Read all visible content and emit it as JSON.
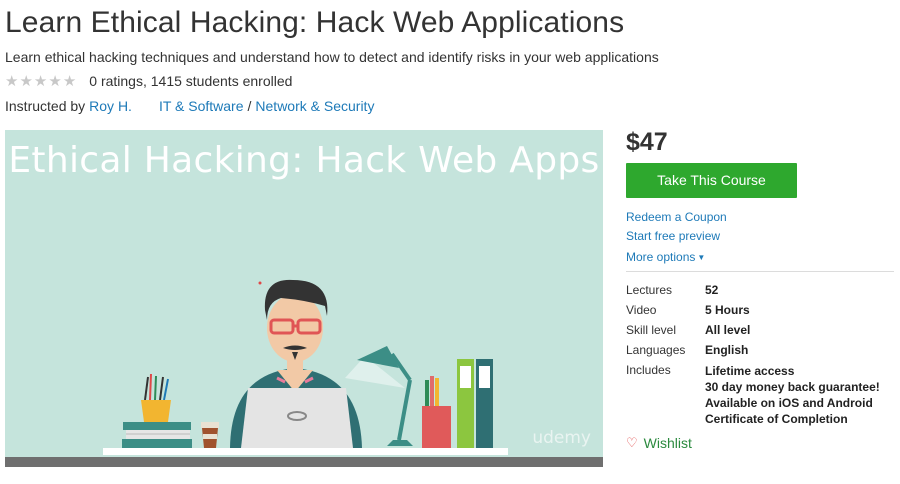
{
  "course": {
    "title": "Learn Ethical Hacking: Hack Web Applications",
    "subtitle": "Learn ethical hacking techniques and understand how to detect and identify risks in your web applications",
    "rating": 0,
    "rating_text": "0 ratings, 1415 students enrolled",
    "instructed_by": "Instructed by",
    "instructor": "Roy H.",
    "category": "IT & Software",
    "category_sep": "/",
    "subcategory": "Network & Security"
  },
  "hero": {
    "banner_text": "Ethical Hacking: Hack Web Apps",
    "brand": "udemy",
    "bg_color": "#c5e4dc"
  },
  "sidebar": {
    "price": "$47",
    "cta_label": "Take This Course",
    "cta_color": "#2ea82e",
    "redeem_coupon": "Redeem a Coupon",
    "free_preview": "Start free preview",
    "more_options": "More options",
    "details": [
      {
        "label": "Lectures",
        "value": [
          "52"
        ]
      },
      {
        "label": "Video",
        "value": [
          "5 Hours"
        ]
      },
      {
        "label": "Skill level",
        "value": [
          "All level"
        ]
      },
      {
        "label": "Languages",
        "value": [
          "English"
        ]
      },
      {
        "label": "Includes",
        "value": [
          "Lifetime access",
          "30 day money back guarantee!",
          "Available on iOS and Android",
          "Certificate of Completion"
        ]
      }
    ],
    "wishlist": "Wishlist"
  },
  "icons": {
    "star": "star-icon",
    "heart": "heart-icon",
    "caret": "caret-down-icon"
  }
}
